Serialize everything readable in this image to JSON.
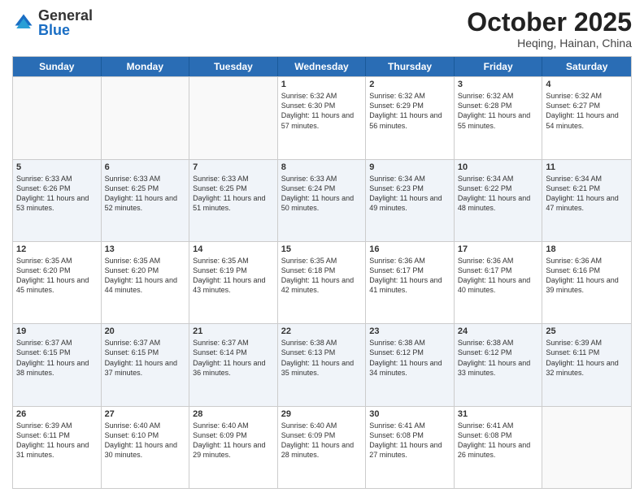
{
  "header": {
    "logo": {
      "general": "General",
      "blue": "Blue"
    },
    "title": "October 2025",
    "subtitle": "Heqing, Hainan, China"
  },
  "calendar": {
    "days": [
      "Sunday",
      "Monday",
      "Tuesday",
      "Wednesday",
      "Thursday",
      "Friday",
      "Saturday"
    ],
    "rows": [
      [
        {
          "day": "",
          "empty": true
        },
        {
          "day": "",
          "empty": true
        },
        {
          "day": "",
          "empty": true
        },
        {
          "day": "1",
          "sunrise": "6:32 AM",
          "sunset": "6:30 PM",
          "daylight": "11 hours and 57 minutes."
        },
        {
          "day": "2",
          "sunrise": "6:32 AM",
          "sunset": "6:29 PM",
          "daylight": "11 hours and 56 minutes."
        },
        {
          "day": "3",
          "sunrise": "6:32 AM",
          "sunset": "6:28 PM",
          "daylight": "11 hours and 55 minutes."
        },
        {
          "day": "4",
          "sunrise": "6:32 AM",
          "sunset": "6:27 PM",
          "daylight": "11 hours and 54 minutes."
        }
      ],
      [
        {
          "day": "5",
          "sunrise": "6:33 AM",
          "sunset": "6:26 PM",
          "daylight": "11 hours and 53 minutes."
        },
        {
          "day": "6",
          "sunrise": "6:33 AM",
          "sunset": "6:25 PM",
          "daylight": "11 hours and 52 minutes."
        },
        {
          "day": "7",
          "sunrise": "6:33 AM",
          "sunset": "6:25 PM",
          "daylight": "11 hours and 51 minutes."
        },
        {
          "day": "8",
          "sunrise": "6:33 AM",
          "sunset": "6:24 PM",
          "daylight": "11 hours and 50 minutes."
        },
        {
          "day": "9",
          "sunrise": "6:34 AM",
          "sunset": "6:23 PM",
          "daylight": "11 hours and 49 minutes."
        },
        {
          "day": "10",
          "sunrise": "6:34 AM",
          "sunset": "6:22 PM",
          "daylight": "11 hours and 48 minutes."
        },
        {
          "day": "11",
          "sunrise": "6:34 AM",
          "sunset": "6:21 PM",
          "daylight": "11 hours and 47 minutes."
        }
      ],
      [
        {
          "day": "12",
          "sunrise": "6:35 AM",
          "sunset": "6:20 PM",
          "daylight": "11 hours and 45 minutes."
        },
        {
          "day": "13",
          "sunrise": "6:35 AM",
          "sunset": "6:20 PM",
          "daylight": "11 hours and 44 minutes."
        },
        {
          "day": "14",
          "sunrise": "6:35 AM",
          "sunset": "6:19 PM",
          "daylight": "11 hours and 43 minutes."
        },
        {
          "day": "15",
          "sunrise": "6:35 AM",
          "sunset": "6:18 PM",
          "daylight": "11 hours and 42 minutes."
        },
        {
          "day": "16",
          "sunrise": "6:36 AM",
          "sunset": "6:17 PM",
          "daylight": "11 hours and 41 minutes."
        },
        {
          "day": "17",
          "sunrise": "6:36 AM",
          "sunset": "6:17 PM",
          "daylight": "11 hours and 40 minutes."
        },
        {
          "day": "18",
          "sunrise": "6:36 AM",
          "sunset": "6:16 PM",
          "daylight": "11 hours and 39 minutes."
        }
      ],
      [
        {
          "day": "19",
          "sunrise": "6:37 AM",
          "sunset": "6:15 PM",
          "daylight": "11 hours and 38 minutes."
        },
        {
          "day": "20",
          "sunrise": "6:37 AM",
          "sunset": "6:15 PM",
          "daylight": "11 hours and 37 minutes."
        },
        {
          "day": "21",
          "sunrise": "6:37 AM",
          "sunset": "6:14 PM",
          "daylight": "11 hours and 36 minutes."
        },
        {
          "day": "22",
          "sunrise": "6:38 AM",
          "sunset": "6:13 PM",
          "daylight": "11 hours and 35 minutes."
        },
        {
          "day": "23",
          "sunrise": "6:38 AM",
          "sunset": "6:12 PM",
          "daylight": "11 hours and 34 minutes."
        },
        {
          "day": "24",
          "sunrise": "6:38 AM",
          "sunset": "6:12 PM",
          "daylight": "11 hours and 33 minutes."
        },
        {
          "day": "25",
          "sunrise": "6:39 AM",
          "sunset": "6:11 PM",
          "daylight": "11 hours and 32 minutes."
        }
      ],
      [
        {
          "day": "26",
          "sunrise": "6:39 AM",
          "sunset": "6:11 PM",
          "daylight": "11 hours and 31 minutes."
        },
        {
          "day": "27",
          "sunrise": "6:40 AM",
          "sunset": "6:10 PM",
          "daylight": "11 hours and 30 minutes."
        },
        {
          "day": "28",
          "sunrise": "6:40 AM",
          "sunset": "6:09 PM",
          "daylight": "11 hours and 29 minutes."
        },
        {
          "day": "29",
          "sunrise": "6:40 AM",
          "sunset": "6:09 PM",
          "daylight": "11 hours and 28 minutes."
        },
        {
          "day": "30",
          "sunrise": "6:41 AM",
          "sunset": "6:08 PM",
          "daylight": "11 hours and 27 minutes."
        },
        {
          "day": "31",
          "sunrise": "6:41 AM",
          "sunset": "6:08 PM",
          "daylight": "11 hours and 26 minutes."
        },
        {
          "day": "",
          "empty": true
        }
      ]
    ],
    "labels": {
      "sunrise": "Sunrise:",
      "sunset": "Sunset:",
      "daylight": "Daylight:"
    }
  }
}
